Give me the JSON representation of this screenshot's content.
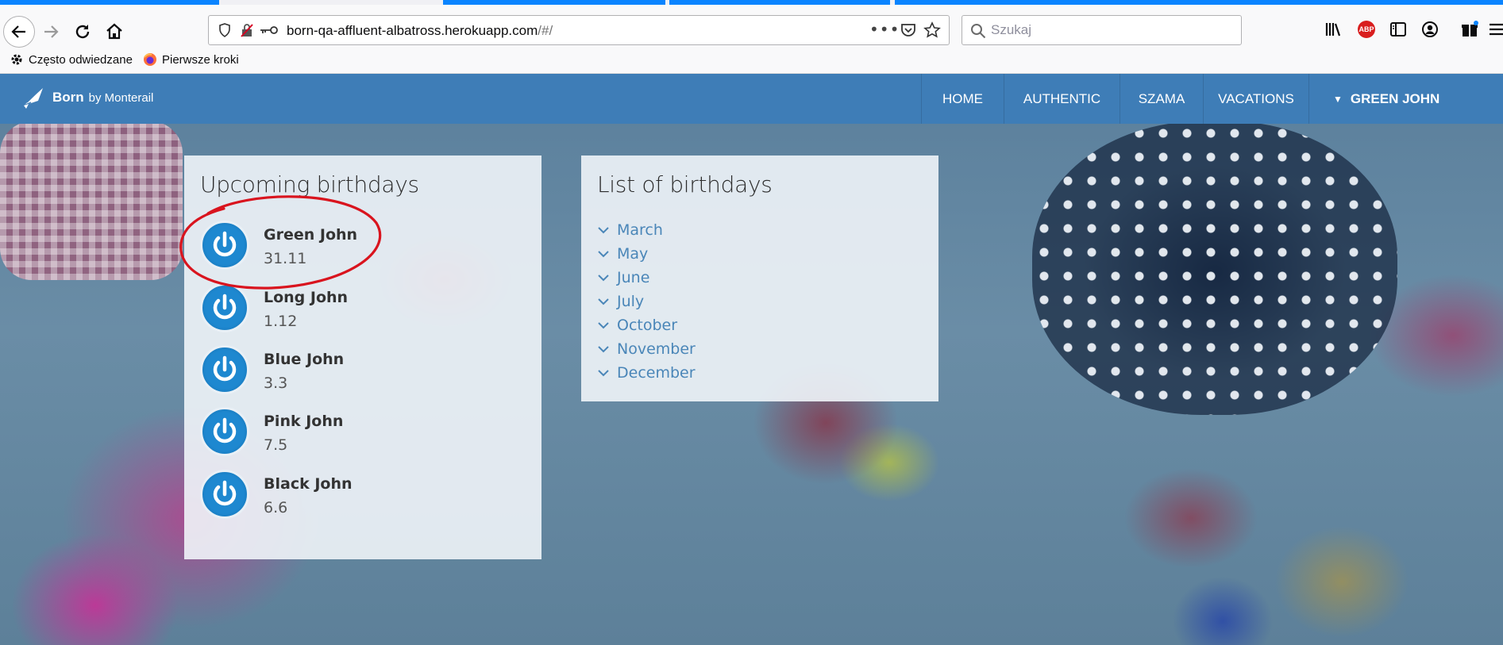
{
  "browser": {
    "url": "born-qa-affluent-albatross.herokuapp.com",
    "url_path": "/#/",
    "more_dots": "•••",
    "search_placeholder": "Szukaj",
    "abp_label": "ABP",
    "bookmarks": [
      {
        "label": "Często odwiedzane",
        "icon": "gear-icon"
      },
      {
        "label": "Pierwsze kroki",
        "icon": "firefox-icon"
      }
    ]
  },
  "app": {
    "brand_name": "Born",
    "brand_by": "by Monterail",
    "nav": [
      "HOME",
      "AUTHENTIC",
      "SZAMA",
      "VACATIONS"
    ],
    "user_label": "GREEN JOHN",
    "colors": {
      "navbar": "#3e7db7",
      "avatar": "#1e88d0",
      "month_link": "#4a86b8",
      "annotation": "#d9141e"
    }
  },
  "upcoming": {
    "title": "Upcoming birthdays",
    "people": [
      {
        "name": "Green John",
        "date": "31.11"
      },
      {
        "name": "Long John",
        "date": "1.12"
      },
      {
        "name": "Blue John",
        "date": "3.3"
      },
      {
        "name": "Pink John",
        "date": "7.5"
      },
      {
        "name": "Black John",
        "date": "6.6"
      }
    ]
  },
  "list": {
    "title": "List of birthdays",
    "months": [
      "March",
      "May",
      "June",
      "July",
      "October",
      "November",
      "December"
    ]
  }
}
